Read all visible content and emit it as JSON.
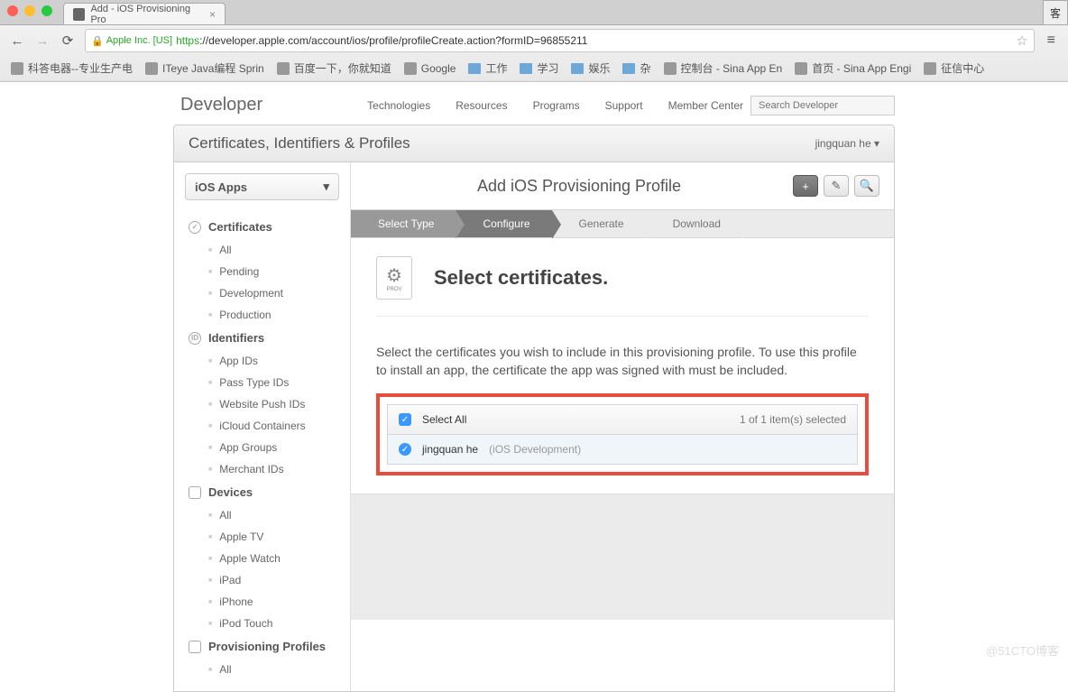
{
  "browser": {
    "tab_title": "Add - iOS Provisioning Pro",
    "company": "Apple Inc. [US]",
    "url_scheme": "https",
    "url_rest": "://developer.apple.com/account/ios/profile/profileCreate.action?formID=96855211",
    "customer_char": "客"
  },
  "bookmarks": [
    {
      "label": "科答电器--专业生产电",
      "type": "page"
    },
    {
      "label": "ITeye Java编程 Sprin",
      "type": "page"
    },
    {
      "label": "百度一下，你就知道",
      "type": "page"
    },
    {
      "label": "Google",
      "type": "page"
    },
    {
      "label": "工作",
      "type": "folder"
    },
    {
      "label": "学习",
      "type": "folder"
    },
    {
      "label": "娱乐",
      "type": "folder"
    },
    {
      "label": "杂",
      "type": "folder"
    },
    {
      "label": "控制台 - Sina App En",
      "type": "page"
    },
    {
      "label": "首页 - Sina App Engi",
      "type": "page"
    },
    {
      "label": "征信中心",
      "type": "page"
    }
  ],
  "header": {
    "brand": "Developer",
    "nav": [
      "Technologies",
      "Resources",
      "Programs",
      "Support",
      "Member Center"
    ],
    "search_placeholder": "Search Developer"
  },
  "section": {
    "title": "Certificates, Identifiers & Profiles",
    "user": "jingquan he"
  },
  "sidebar": {
    "platform": "iOS Apps",
    "groups": [
      {
        "name": "Certificates",
        "icon": "check",
        "items": [
          "All",
          "Pending",
          "Development",
          "Production"
        ]
      },
      {
        "name": "Identifiers",
        "icon": "id",
        "items": [
          "App IDs",
          "Pass Type IDs",
          "Website Push IDs",
          "iCloud Containers",
          "App Groups",
          "Merchant IDs"
        ]
      },
      {
        "name": "Devices",
        "icon": "device",
        "items": [
          "All",
          "Apple TV",
          "Apple Watch",
          "iPad",
          "iPhone",
          "iPod Touch"
        ]
      },
      {
        "name": "Provisioning Profiles",
        "icon": "prov",
        "items": [
          "All"
        ]
      }
    ]
  },
  "main": {
    "title": "Add iOS Provisioning Profile",
    "steps": [
      "Select Type",
      "Configure",
      "Generate",
      "Download"
    ],
    "active_step": 1,
    "heading": "Select certificates.",
    "prov_label": "PROV",
    "instructions": "Select the certificates you wish to include in this provisioning profile. To use this profile to install an app, the certificate the app was signed with must be included.",
    "select_all": "Select All",
    "count_text": "1 of 1 item(s) selected",
    "certs": [
      {
        "name": "jingquan he",
        "type": "(iOS Development)",
        "checked": true
      }
    ]
  },
  "watermark": "@51CTO博客"
}
